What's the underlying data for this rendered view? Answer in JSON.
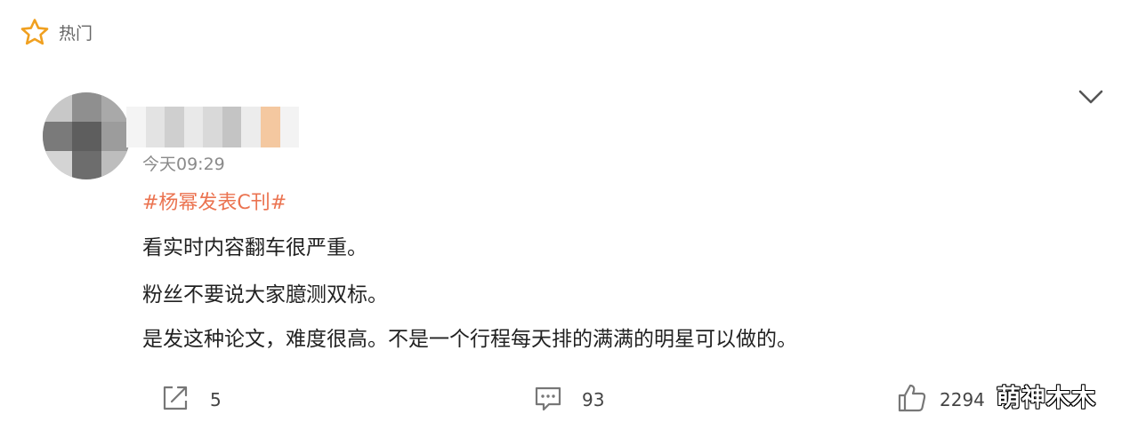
{
  "header": {
    "icon": "star-icon",
    "label": "热门"
  },
  "post": {
    "time": "今天09:29",
    "topic": "#杨幂发表C刊#",
    "lines": [
      "看实时内容翻车很严重。",
      "粉丝不要说大家臆测双标。",
      "是发这种论文，难度很高。不是一个行程每天排的满满的明星可以做的。"
    ]
  },
  "actions": {
    "share_count": "5",
    "comment_count": "93",
    "like_count": "2294"
  },
  "watermark": "萌神木木",
  "colors": {
    "topic": "#eb7350",
    "icon_gray": "#777777",
    "time_gray": "#8a8a8a",
    "text": "#222222"
  }
}
